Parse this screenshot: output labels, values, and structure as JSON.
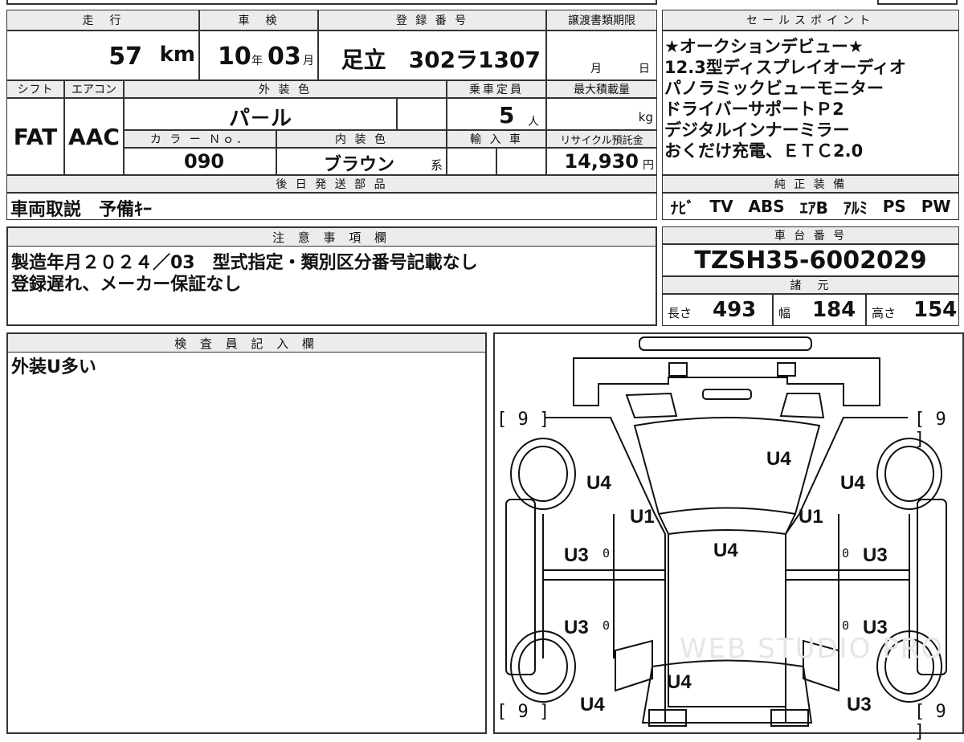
{
  "labels": {
    "mileage": "走　行",
    "inspection": "車　検",
    "registration": "登 録 番 号",
    "transfer_deadline": "譲渡書類期限",
    "sales_points": "セールスポイント",
    "shift": "シフト",
    "aircon": "エアコン",
    "exterior_color": "外 装 色",
    "capacity": "乗車定員",
    "max_load": "最大積載量",
    "color_no": "カ ラ ー Ｎｏ．",
    "interior_color": "内 装 色",
    "import": "輸 入 車",
    "recycle": "リサイクル預託金",
    "later_parts": "後 日 発 送 部 品",
    "standard_equipment": "純 正 装 備",
    "notes": "注 意 事 項 欄",
    "chassis_no": "車 台 番 号",
    "specs": "諸　元",
    "inspector": "検 査 員 記 入 欄"
  },
  "vehicle": {
    "mileage": "57",
    "mileage_unit": "km",
    "inspect_year": "10",
    "inspect_year_unit": "年",
    "inspect_month": "03",
    "inspect_month_unit": "月",
    "registration_no": "足立　302ラ1307",
    "deadline_month": "月",
    "deadline_day": "日",
    "shift": "FAT",
    "aircon": "AAC",
    "exterior_color": "パ－ル",
    "capacity": "5",
    "capacity_unit": "人",
    "max_load_unit": "kg",
    "color_no": "090",
    "interior_color": "ブラウン",
    "interior_suffix": "系",
    "recycle_fee": "14,930",
    "recycle_unit": "円",
    "later_parts": "車両取説　予備ｷｰ",
    "chassis_no": "TZSH35-6002029",
    "length_label": "長さ",
    "length": "493",
    "width_label": "幅",
    "width": "184",
    "height_label": "高さ",
    "height": "154"
  },
  "sales_points": [
    "★オークションデビュー★",
    "12.3型ディスプレイオーディオ",
    "パノラミックビューモニター",
    "ドライバーサポートＰ2",
    "デジタルインナーミラー",
    "おくだけ充電、ＥＴＣ2.0"
  ],
  "equipment": [
    "ﾅﾋﾞ",
    "TV",
    "ABS",
    "ｴｱB",
    "ｱﾙﾐ",
    "PS",
    "PW"
  ],
  "notes": [
    "製造年月２０２４／03　型式指定・類別区分番号記載なし",
    "登録遅れ、メーカー保証なし"
  ],
  "inspector_note": "外装U多い",
  "diagram": {
    "tire_marks": [
      "[ 9 ]",
      "[ 9 ]",
      "[ 9 ]",
      "[ 9 ]"
    ],
    "marks": [
      "U4",
      "U4",
      "U4",
      "U1",
      "U1",
      "U4",
      "U3",
      "U3",
      "U3",
      "U3",
      "U4",
      "U4",
      "U3"
    ],
    "zeros": [
      "0",
      "0",
      "0",
      "0"
    ],
    "watermark": "WEB STUDIO PRO"
  }
}
